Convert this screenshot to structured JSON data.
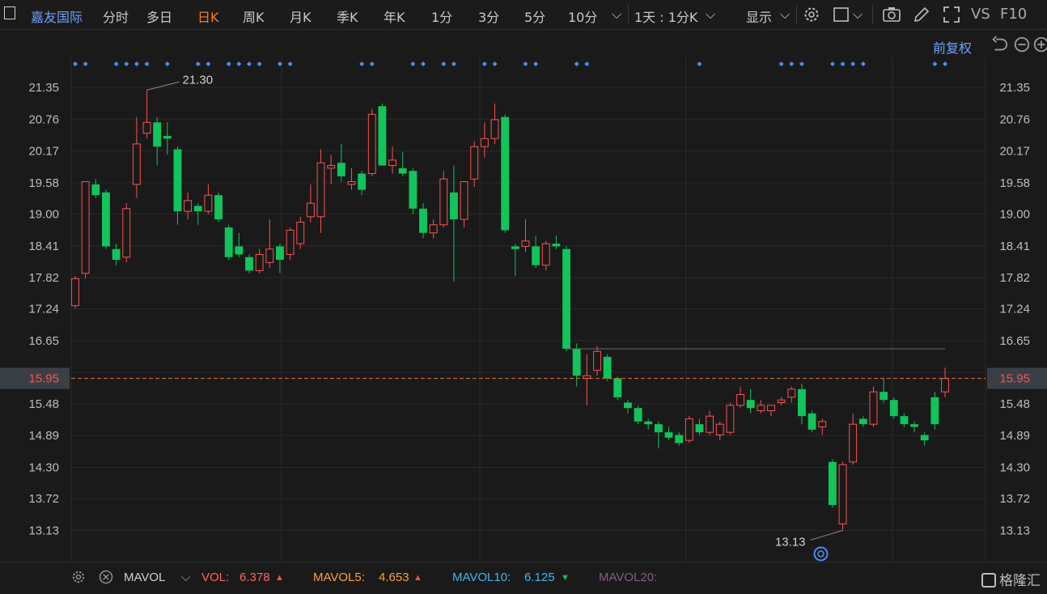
{
  "toolbar": {
    "stock_name": "嘉友国际",
    "tabs": [
      "分时",
      "多日",
      "日K",
      "周K",
      "月K",
      "季K",
      "年K",
      "1分",
      "3分",
      "5分",
      "10分"
    ],
    "active_tab": "日K",
    "period_select": "1天 : 1分K",
    "display_label": "显示",
    "vs_label": "VS",
    "f10_label": "F10"
  },
  "sub_toolbar": {
    "adjust_label": "前复权"
  },
  "chart_data": {
    "type": "candlestick",
    "y_ticks": [
      "21.35",
      "20.76",
      "20.17",
      "19.58",
      "19.00",
      "18.41",
      "17.82",
      "17.24",
      "16.65",
      "16.06",
      "15.48",
      "14.89",
      "14.30",
      "13.72",
      "13.13"
    ],
    "ylim": [
      12.55,
      21.92
    ],
    "current_price": "15.95",
    "high_label": "21.30",
    "low_label": "13.13",
    "resistance_level": 16.5,
    "up_color": "#ff5050",
    "down_color": "#11c45b",
    "grid": true,
    "candles": [
      {
        "o": 17.3,
        "h": 17.85,
        "l": 17.25,
        "c": 17.8
      },
      {
        "o": 17.9,
        "h": 19.6,
        "l": 17.8,
        "c": 19.6
      },
      {
        "o": 19.55,
        "h": 19.65,
        "l": 19.3,
        "c": 19.35
      },
      {
        "o": 19.4,
        "h": 19.45,
        "l": 18.35,
        "c": 18.4
      },
      {
        "o": 18.35,
        "h": 18.45,
        "l": 18.05,
        "c": 18.15
      },
      {
        "o": 18.2,
        "h": 19.2,
        "l": 18.1,
        "c": 19.1
      },
      {
        "o": 19.55,
        "h": 20.8,
        "l": 19.3,
        "c": 20.3
      },
      {
        "o": 20.5,
        "h": 21.3,
        "l": 20.4,
        "c": 20.7
      },
      {
        "o": 20.7,
        "h": 20.8,
        "l": 19.9,
        "c": 20.25
      },
      {
        "o": 20.45,
        "h": 20.7,
        "l": 20.1,
        "c": 20.4
      },
      {
        "o": 20.2,
        "h": 20.25,
        "l": 18.8,
        "c": 19.05
      },
      {
        "o": 19.05,
        "h": 19.4,
        "l": 18.9,
        "c": 19.25
      },
      {
        "o": 19.15,
        "h": 19.2,
        "l": 18.8,
        "c": 19.05
      },
      {
        "o": 19.05,
        "h": 19.55,
        "l": 19.0,
        "c": 19.35
      },
      {
        "o": 19.35,
        "h": 19.4,
        "l": 18.85,
        "c": 18.9
      },
      {
        "o": 18.75,
        "h": 18.8,
        "l": 18.15,
        "c": 18.2
      },
      {
        "o": 18.4,
        "h": 18.65,
        "l": 18.2,
        "c": 18.25
      },
      {
        "o": 18.2,
        "h": 18.25,
        "l": 17.9,
        "c": 17.95
      },
      {
        "o": 17.95,
        "h": 18.35,
        "l": 17.9,
        "c": 18.25
      },
      {
        "o": 18.1,
        "h": 18.9,
        "l": 18.0,
        "c": 18.35
      },
      {
        "o": 18.4,
        "h": 18.45,
        "l": 17.9,
        "c": 18.15
      },
      {
        "o": 18.25,
        "h": 18.75,
        "l": 18.15,
        "c": 18.7
      },
      {
        "o": 18.45,
        "h": 18.95,
        "l": 18.35,
        "c": 18.85
      },
      {
        "o": 18.95,
        "h": 19.55,
        "l": 18.85,
        "c": 19.2
      },
      {
        "o": 18.95,
        "h": 20.2,
        "l": 18.65,
        "c": 19.95
      },
      {
        "o": 19.85,
        "h": 20.1,
        "l": 19.55,
        "c": 19.9
      },
      {
        "o": 19.95,
        "h": 20.3,
        "l": 19.6,
        "c": 19.7
      },
      {
        "o": 19.55,
        "h": 19.85,
        "l": 19.45,
        "c": 19.6
      },
      {
        "o": 19.75,
        "h": 19.8,
        "l": 19.35,
        "c": 19.45
      },
      {
        "o": 19.75,
        "h": 20.95,
        "l": 19.7,
        "c": 20.85
      },
      {
        "o": 21.0,
        "h": 21.05,
        "l": 19.95,
        "c": 19.9
      },
      {
        "o": 19.9,
        "h": 20.25,
        "l": 19.75,
        "c": 20.0
      },
      {
        "o": 19.85,
        "h": 20.15,
        "l": 19.7,
        "c": 19.75
      },
      {
        "o": 19.8,
        "h": 19.85,
        "l": 19.0,
        "c": 19.1
      },
      {
        "o": 19.1,
        "h": 19.2,
        "l": 18.55,
        "c": 18.65
      },
      {
        "o": 18.65,
        "h": 18.9,
        "l": 18.55,
        "c": 18.8
      },
      {
        "o": 18.8,
        "h": 19.8,
        "l": 18.75,
        "c": 19.65
      },
      {
        "o": 19.4,
        "h": 19.9,
        "l": 17.75,
        "c": 18.9
      },
      {
        "o": 18.9,
        "h": 19.6,
        "l": 18.75,
        "c": 19.6
      },
      {
        "o": 19.65,
        "h": 20.35,
        "l": 19.5,
        "c": 20.25
      },
      {
        "o": 20.25,
        "h": 20.7,
        "l": 20.05,
        "c": 20.4
      },
      {
        "o": 20.4,
        "h": 21.05,
        "l": 20.3,
        "c": 20.75
      },
      {
        "o": 20.8,
        "h": 20.85,
        "l": 18.65,
        "c": 18.7
      },
      {
        "o": 18.4,
        "h": 18.45,
        "l": 17.85,
        "c": 18.35
      },
      {
        "o": 18.4,
        "h": 18.9,
        "l": 18.3,
        "c": 18.5
      },
      {
        "o": 18.4,
        "h": 18.6,
        "l": 18.0,
        "c": 18.05
      },
      {
        "o": 18.05,
        "h": 18.5,
        "l": 17.95,
        "c": 18.45
      },
      {
        "o": 18.45,
        "h": 18.6,
        "l": 18.35,
        "c": 18.4
      },
      {
        "o": 18.35,
        "h": 18.4,
        "l": 16.45,
        "c": 16.5
      },
      {
        "o": 16.5,
        "h": 16.6,
        "l": 15.8,
        "c": 16.0
      },
      {
        "o": 15.95,
        "h": 16.4,
        "l": 15.45,
        "c": 16.0
      },
      {
        "o": 16.1,
        "h": 16.55,
        "l": 16.0,
        "c": 16.45
      },
      {
        "o": 16.35,
        "h": 16.4,
        "l": 15.9,
        "c": 15.95
      },
      {
        "o": 15.95,
        "h": 15.98,
        "l": 15.55,
        "c": 15.6
      },
      {
        "o": 15.5,
        "h": 15.55,
        "l": 15.3,
        "c": 15.4
      },
      {
        "o": 15.4,
        "h": 15.45,
        "l": 15.1,
        "c": 15.15
      },
      {
        "o": 15.15,
        "h": 15.2,
        "l": 15.0,
        "c": 15.1
      },
      {
        "o": 15.1,
        "h": 15.15,
        "l": 14.65,
        "c": 14.95
      },
      {
        "o": 14.95,
        "h": 15.05,
        "l": 14.8,
        "c": 14.85
      },
      {
        "o": 14.9,
        "h": 14.95,
        "l": 14.7,
        "c": 14.75
      },
      {
        "o": 14.8,
        "h": 15.25,
        "l": 14.75,
        "c": 15.2
      },
      {
        "o": 15.1,
        "h": 15.2,
        "l": 14.9,
        "c": 14.95
      },
      {
        "o": 14.95,
        "h": 15.35,
        "l": 14.9,
        "c": 15.25
      },
      {
        "o": 14.9,
        "h": 15.15,
        "l": 14.8,
        "c": 15.1
      },
      {
        "o": 14.95,
        "h": 15.5,
        "l": 14.9,
        "c": 15.45
      },
      {
        "o": 15.45,
        "h": 15.8,
        "l": 15.4,
        "c": 15.65
      },
      {
        "o": 15.55,
        "h": 15.75,
        "l": 15.3,
        "c": 15.4
      },
      {
        "o": 15.35,
        "h": 15.55,
        "l": 15.3,
        "c": 15.45
      },
      {
        "o": 15.35,
        "h": 15.4,
        "l": 15.25,
        "c": 15.45
      },
      {
        "o": 15.5,
        "h": 15.6,
        "l": 15.45,
        "c": 15.55
      },
      {
        "o": 15.6,
        "h": 15.8,
        "l": 15.5,
        "c": 15.75
      },
      {
        "o": 15.75,
        "h": 15.85,
        "l": 15.1,
        "c": 15.25
      },
      {
        "o": 15.3,
        "h": 15.35,
        "l": 14.95,
        "c": 15.0
      },
      {
        "o": 15.05,
        "h": 15.2,
        "l": 14.9,
        "c": 15.15
      },
      {
        "o": 14.4,
        "h": 14.45,
        "l": 13.55,
        "c": 13.6
      },
      {
        "o": 13.25,
        "h": 14.4,
        "l": 13.13,
        "c": 14.35
      },
      {
        "o": 14.4,
        "h": 15.3,
        "l": 14.35,
        "c": 15.1
      },
      {
        "o": 15.2,
        "h": 15.25,
        "l": 15.05,
        "c": 15.1
      },
      {
        "o": 15.1,
        "h": 15.8,
        "l": 15.05,
        "c": 15.7
      },
      {
        "o": 15.7,
        "h": 15.95,
        "l": 15.5,
        "c": 15.55
      },
      {
        "o": 15.55,
        "h": 15.6,
        "l": 15.2,
        "c": 15.25
      },
      {
        "o": 15.25,
        "h": 15.3,
        "l": 15.05,
        "c": 15.1
      },
      {
        "o": 15.1,
        "h": 15.15,
        "l": 14.95,
        "c": 15.05
      },
      {
        "o": 14.9,
        "h": 14.95,
        "l": 14.7,
        "c": 14.8
      },
      {
        "o": 15.6,
        "h": 15.7,
        "l": 15.0,
        "c": 15.1
      },
      {
        "o": 15.7,
        "h": 16.15,
        "l": 15.6,
        "c": 15.95
      }
    ],
    "markers": [
      0,
      1,
      4,
      5,
      6,
      7,
      9,
      12,
      13,
      15,
      16,
      17,
      18,
      20,
      21,
      28,
      29,
      33,
      34,
      36,
      37,
      40,
      41,
      44,
      45,
      49,
      50,
      61,
      69,
      70,
      71,
      74,
      75,
      76,
      77,
      84,
      85
    ]
  },
  "indicator_bar": {
    "name": "MAVOL",
    "vol_label": "VOL:",
    "vol_value": "6.378",
    "mavol5_label": "MAVOL5:",
    "mavol5_value": "4.653",
    "mavol10_label": "MAVOL10:",
    "mavol10_value": "6.125",
    "mavol20_label": "MAVOL20:",
    "brand": "格隆汇"
  }
}
